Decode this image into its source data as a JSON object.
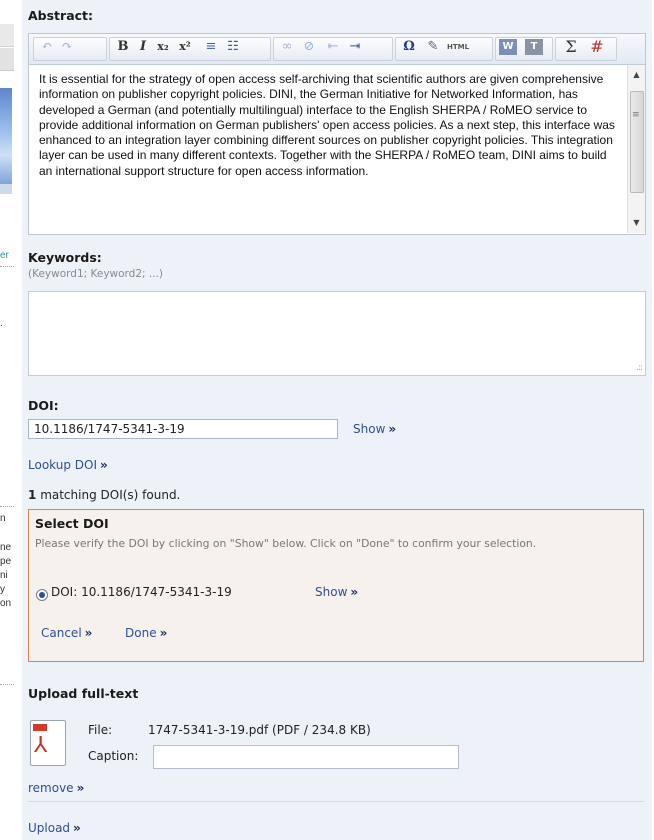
{
  "left_column": {
    "fragments": [
      "er",
      ".",
      "n",
      "ne",
      "pe",
      "ni",
      "y",
      "on"
    ]
  },
  "abstract": {
    "label": "Abstract:",
    "toolbar": {
      "undo": "↶",
      "redo": "↷",
      "bold": "B",
      "italic": "I",
      "subscript": "x₂",
      "superscript": "x²",
      "ordered_list": "≡",
      "unordered_list": "☷",
      "link": "∞",
      "unlink": "⊘",
      "outdent": "⇤",
      "indent": "⇥",
      "special_char": "Ω",
      "cleanup": "✎",
      "html": "HTML",
      "paste_word": "W",
      "paste_text": "T",
      "sum": "Σ",
      "math": "#"
    },
    "text": "It is essential for the strategy of open access self-archiving that scientific authors are given comprehensive information on publisher copyright policies. DINI, the German Initiative for Networked Information, has developed a German (and potentially multilingual) interface to the English SHERPA / RoMEO service to provide additional information on German publishers' open access policies. As a next step, this interface was enhanced to an integration layer combining different sources on publisher copyright policies. This integration layer can be used in many different contexts. Together with the SHERPA / RoMEO team, DINI aims to build an international support structure for open access information."
  },
  "keywords": {
    "label": "Keywords:",
    "hint": "(Keyword1; Keyword2; ...)",
    "value": ""
  },
  "doi": {
    "label": "DOI:",
    "value": "10.1186/1747-5341-3-19",
    "show_label": "Show",
    "lookup_label": "Lookup DOI",
    "chevron": "»",
    "match_count": "1",
    "match_text": "matching DOI(s) found."
  },
  "select_doi": {
    "title": "Select DOI",
    "description": "Please verify the DOI by clicking on \"Show\" below. Click on \"Done\" to confirm your selection.",
    "option_label": "DOI: 10.1186/1747-5341-3-19",
    "option_selected": true,
    "show_label": "Show",
    "cancel_label": "Cancel",
    "done_label": "Done",
    "border_color": "#e0814c"
  },
  "upload": {
    "title": "Upload full-text",
    "file_label": "File:",
    "file_value": "1747-5341-3-19.pdf (PDF / 234.8 KB)",
    "caption_label": "Caption:",
    "caption_value": "",
    "remove_label": "remove",
    "upload_label": "Upload",
    "file_icon": "pdf-icon"
  }
}
